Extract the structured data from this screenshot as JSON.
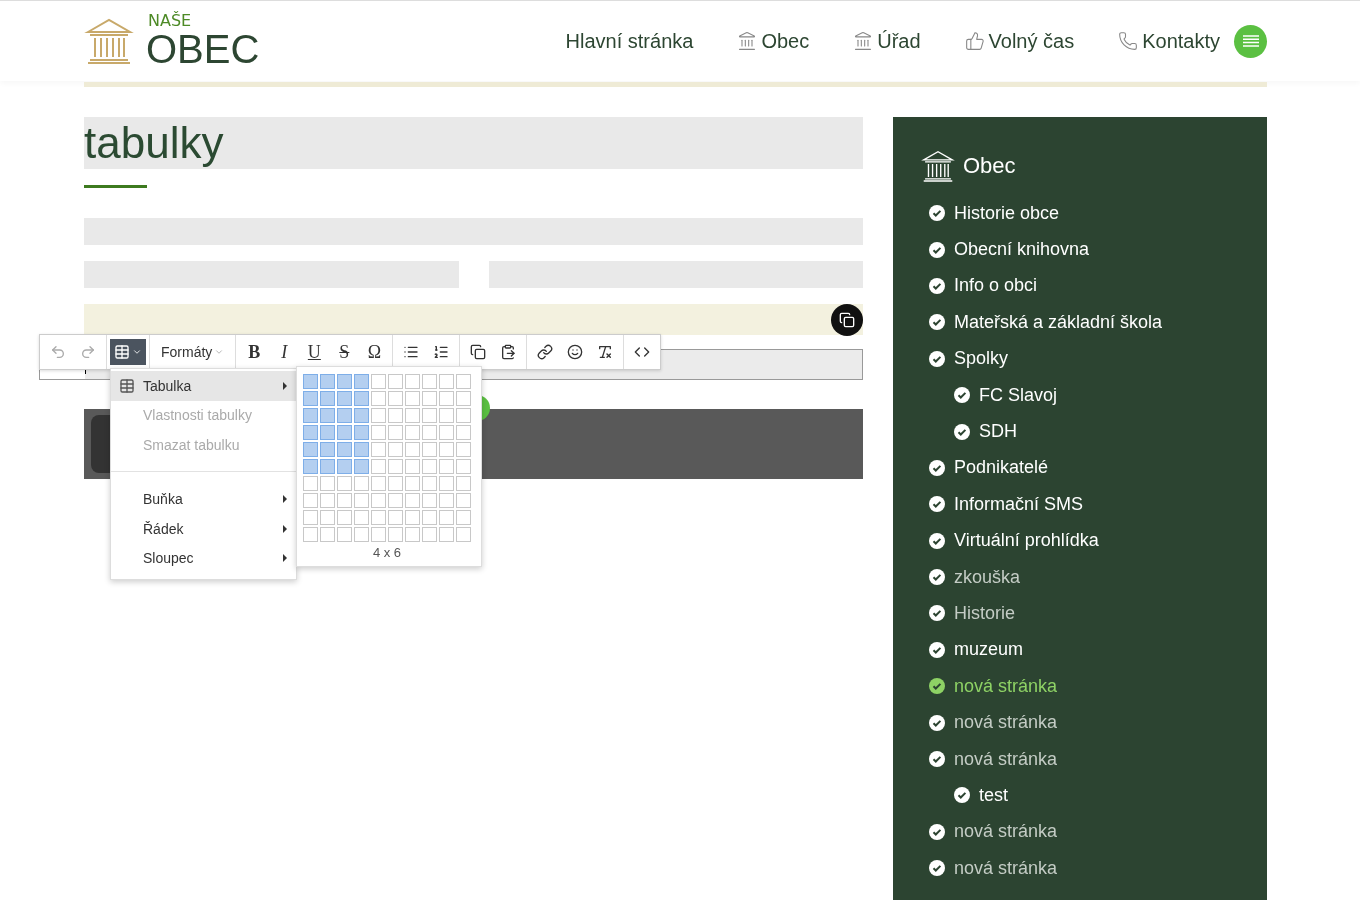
{
  "header": {
    "logo": {
      "small": "NAŠE",
      "big": "OBEC"
    },
    "nav": [
      {
        "label": "Hlavní stránka",
        "kind": "text"
      },
      {
        "label": "Obec",
        "kind": "building"
      },
      {
        "label": "Úřad",
        "kind": "building"
      },
      {
        "label": "Volný čas",
        "kind": "thumb"
      },
      {
        "label": "Kontakty",
        "kind": "phone"
      }
    ]
  },
  "page": {
    "title": "tabulky"
  },
  "editor": {
    "toolbar": [
      {
        "kind": "undo",
        "disabled": true
      },
      {
        "kind": "redo",
        "disabled": true
      },
      {
        "kind": "table",
        "active": true
      },
      {
        "kind": "dropdown",
        "label": "Formáty"
      },
      {
        "kind": "bold",
        "label": "B"
      },
      {
        "kind": "italic",
        "label": "I"
      },
      {
        "kind": "underline",
        "label": "U"
      },
      {
        "kind": "strike",
        "label": "S"
      },
      {
        "kind": "glyph",
        "label": "Ω"
      },
      {
        "kind": "bullets"
      },
      {
        "kind": "numbers"
      },
      {
        "kind": "copy"
      },
      {
        "kind": "paste"
      },
      {
        "kind": "link"
      },
      {
        "kind": "emoji"
      },
      {
        "kind": "clear"
      },
      {
        "kind": "code"
      }
    ],
    "menu": [
      {
        "label": "Tabulka",
        "selected": true,
        "disabled": false,
        "submenu": true,
        "icon": true
      },
      {
        "label": "Vlastnosti tabulky",
        "selected": false,
        "disabled": true,
        "submenu": false,
        "icon": false
      },
      {
        "label": "Smazat tabulku",
        "selected": false,
        "disabled": true,
        "submenu": false,
        "icon": false,
        "separator_after": true
      },
      {
        "label": "Buňka",
        "selected": false,
        "disabled": false,
        "submenu": true,
        "icon": false
      },
      {
        "label": "Řádek",
        "selected": false,
        "disabled": false,
        "submenu": true,
        "icon": false
      },
      {
        "label": "Sloupec",
        "selected": false,
        "disabled": false,
        "submenu": true,
        "icon": false
      }
    ],
    "picker": {
      "size_label": "4 x 6",
      "rows": [
        [
          true,
          true,
          true,
          true,
          false,
          false,
          false,
          false,
          false,
          false
        ],
        [
          true,
          true,
          true,
          true,
          false,
          false,
          false,
          false,
          false,
          false
        ],
        [
          true,
          true,
          true,
          true,
          false,
          false,
          false,
          false,
          false,
          false
        ],
        [
          true,
          true,
          true,
          true,
          false,
          false,
          false,
          false,
          false,
          false
        ],
        [
          true,
          true,
          true,
          true,
          false,
          false,
          false,
          false,
          false,
          false
        ],
        [
          true,
          true,
          true,
          true,
          false,
          false,
          false,
          false,
          false,
          false
        ],
        [
          false,
          false,
          false,
          false,
          false,
          false,
          false,
          false,
          false,
          false
        ],
        [
          false,
          false,
          false,
          false,
          false,
          false,
          false,
          false,
          false,
          false
        ],
        [
          false,
          false,
          false,
          false,
          false,
          false,
          false,
          false,
          false,
          false
        ],
        [
          false,
          false,
          false,
          false,
          false,
          false,
          false,
          false,
          false,
          false
        ]
      ]
    }
  },
  "sidebar": {
    "title": "Obec",
    "items": [
      {
        "label": "Historie obce",
        "selected": false,
        "dimmed": false
      },
      {
        "label": "Obecní knihovna",
        "selected": false,
        "dimmed": false
      },
      {
        "label": "Info o obci",
        "selected": false,
        "dimmed": false
      },
      {
        "label": "Mateřská a základní škola",
        "selected": false,
        "dimmed": false
      },
      {
        "label": "Spolky",
        "selected": false,
        "dimmed": false,
        "children": [
          {
            "label": "FC Slavoj",
            "selected": false,
            "dimmed": false
          },
          {
            "label": "SDH",
            "selected": false,
            "dimmed": false
          }
        ]
      },
      {
        "label": "Podnikatelé",
        "selected": false,
        "dimmed": false
      },
      {
        "label": "Informační SMS",
        "selected": false,
        "dimmed": false
      },
      {
        "label": "Virtuální prohlídka",
        "selected": false,
        "dimmed": false
      },
      {
        "label": "zkouška",
        "selected": false,
        "dimmed": true
      },
      {
        "label": "Historie",
        "selected": false,
        "dimmed": true
      },
      {
        "label": "muzeum",
        "selected": false,
        "dimmed": false
      },
      {
        "label": "nová stránka",
        "selected": true,
        "dimmed": false
      },
      {
        "label": "nová stránka",
        "selected": false,
        "dimmed": true
      },
      {
        "label": "nová stránka",
        "selected": false,
        "dimmed": true,
        "children": [
          {
            "label": "test",
            "selected": false,
            "dimmed": false
          }
        ]
      },
      {
        "label": "nová stránka",
        "selected": false,
        "dimmed": true
      },
      {
        "label": "nová stránka",
        "selected": false,
        "dimmed": true
      }
    ]
  }
}
